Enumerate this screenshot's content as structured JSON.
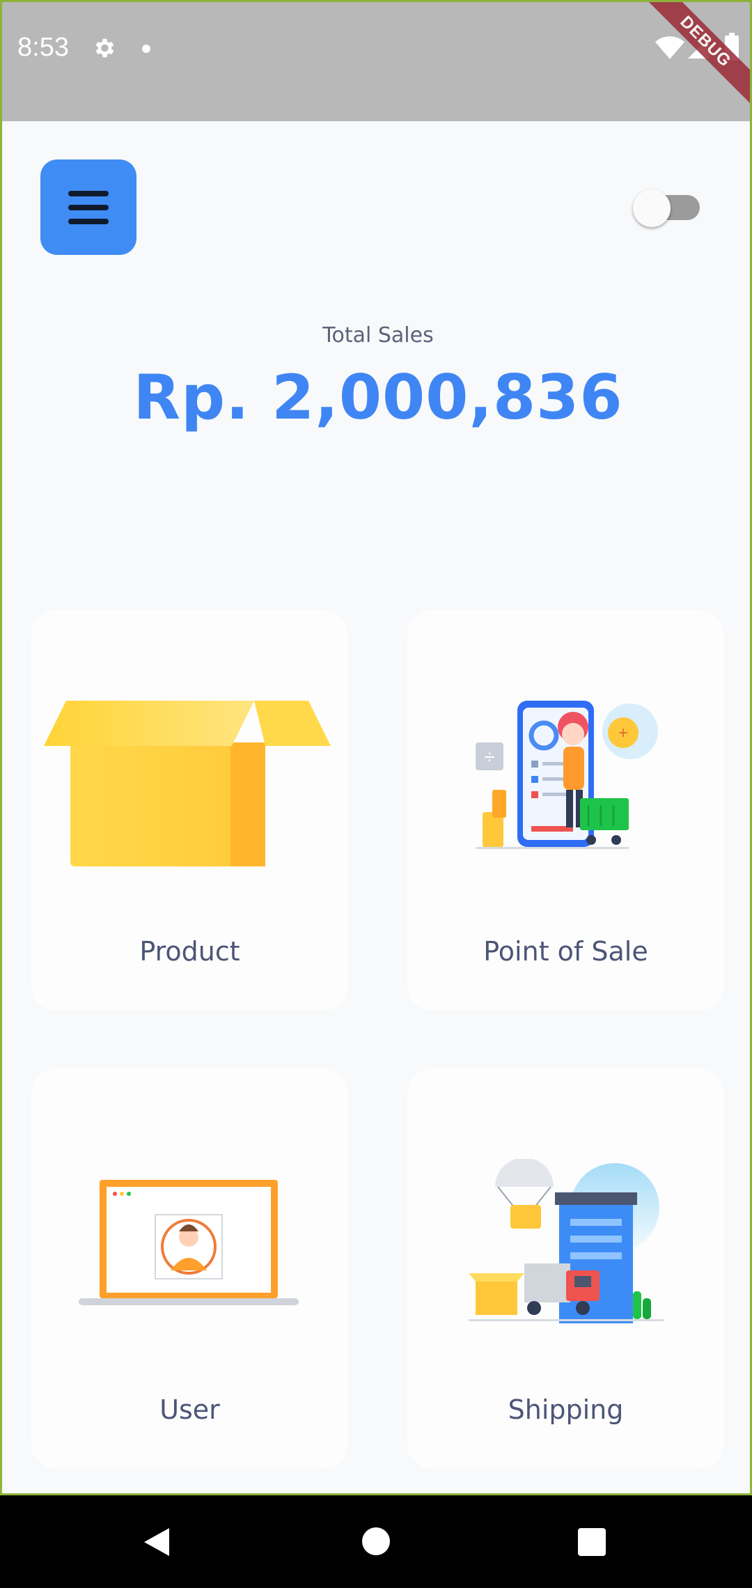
{
  "status_bar": {
    "time": "8:53",
    "debug_label": "DEBUG"
  },
  "header": {
    "menu_icon": "hamburger-menu-icon",
    "theme_toggle": {
      "state": "off"
    }
  },
  "sales": {
    "label": "Total Sales",
    "value": "Rp. 2,000,836"
  },
  "menu_cards": [
    {
      "label": "Product",
      "icon": "box-illustration"
    },
    {
      "label": "Point of Sale",
      "icon": "pos-illustration"
    },
    {
      "label": "User",
      "icon": "user-illustration"
    },
    {
      "label": "Shipping",
      "icon": "shipping-illustration"
    }
  ],
  "colors": {
    "accent": "#3f86f4",
    "menu_button": "#3f8cf5",
    "card_label": "#4c5577",
    "background": "#f8f9fb"
  }
}
